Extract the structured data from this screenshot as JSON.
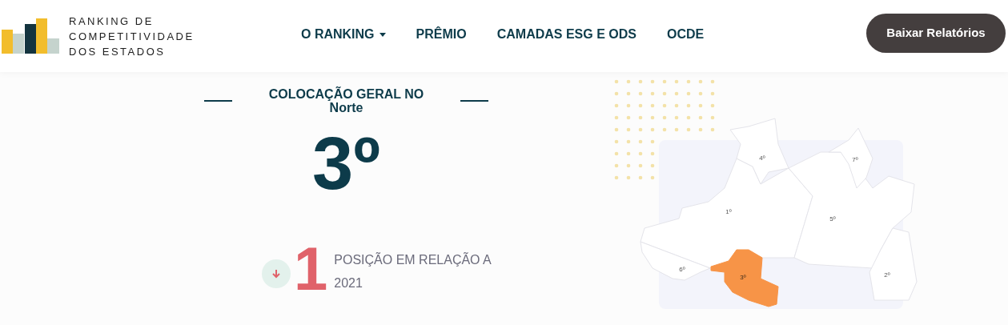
{
  "logo": {
    "lines": [
      "RANKING DE",
      "COMPETITIVIDADE",
      "DOS ESTADOS"
    ]
  },
  "nav": [
    {
      "label": "O RANKING",
      "dropdown": true
    },
    {
      "label": "PRÊMIO",
      "dropdown": false
    },
    {
      "label": "CAMADAS ESG E ODS",
      "dropdown": false
    },
    {
      "label": "OCDE",
      "dropdown": false
    }
  ],
  "download_button": "Baixar Relatórios",
  "placement": {
    "title": "COLOCAÇÃO GERAL NO",
    "region": "Norte",
    "rank": "3º"
  },
  "change": {
    "decreased": true,
    "amount": "1",
    "text": "POSIÇÃO EM RELAÇÃO A 2021"
  },
  "map": {
    "states": [
      {
        "label": "1º",
        "selected": false
      },
      {
        "label": "4º",
        "selected": false
      },
      {
        "label": "5º",
        "selected": false
      },
      {
        "label": "7º",
        "selected": false
      },
      {
        "label": "2º",
        "selected": false
      },
      {
        "label": "6º",
        "selected": false
      },
      {
        "label": "3º",
        "selected": true
      }
    ]
  }
}
